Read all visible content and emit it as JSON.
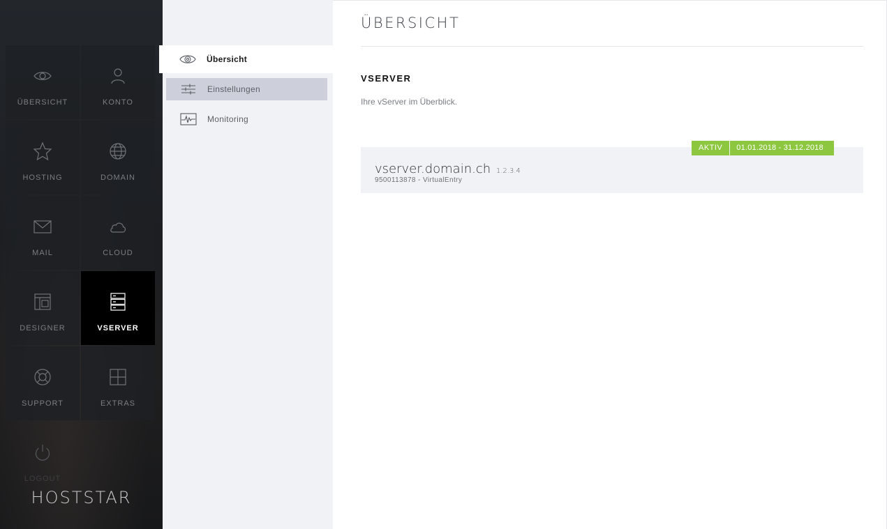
{
  "sidebar": {
    "tiles": [
      {
        "label": "ÜBERSICHT",
        "icon": "eye-icon"
      },
      {
        "label": "KONTO",
        "icon": "user-icon"
      },
      {
        "label": "HOSTING",
        "icon": "star-icon"
      },
      {
        "label": "DOMAIN",
        "icon": "globe-icon"
      },
      {
        "label": "MAIL",
        "icon": "envelope-icon"
      },
      {
        "label": "CLOUD",
        "icon": "cloud-icon"
      },
      {
        "label": "DESIGNER",
        "icon": "layout-icon"
      },
      {
        "label": "VSERVER",
        "icon": "server-icon",
        "active": true
      },
      {
        "label": "SUPPORT",
        "icon": "lifebuoy-icon"
      },
      {
        "label": "EXTRAS",
        "icon": "plus-square-icon"
      },
      {
        "label": "LOGOUT",
        "icon": "power-icon"
      }
    ],
    "brand": "HOSTSTAR"
  },
  "submenu": {
    "items": [
      {
        "label": "Übersicht",
        "icon": "eye-icon",
        "state": "current"
      },
      {
        "label": "Einstellungen",
        "icon": "sliders-icon",
        "state": "hover"
      },
      {
        "label": "Monitoring",
        "icon": "pulse-icon",
        "state": "normal"
      }
    ]
  },
  "main": {
    "page_title": "ÜBERSICHT",
    "section_title": "VSERVER",
    "section_desc": "Ihre vServer im Überblick.",
    "server": {
      "name": "vserver.domain.ch",
      "ip": "1.2.3.4",
      "sub": "9500113878 - VirtualEntry",
      "status": "AKTIV",
      "period": "01.01.2018 - 31.12.2018"
    }
  },
  "colors": {
    "sidebar_bg": "#1e2024",
    "active_tile": "#000000",
    "submenu_bg": "#f1f2f5",
    "submenu_hover": "#cdd0da",
    "badge_green": "#8dc63f",
    "card_bg": "#f1f2f5"
  }
}
